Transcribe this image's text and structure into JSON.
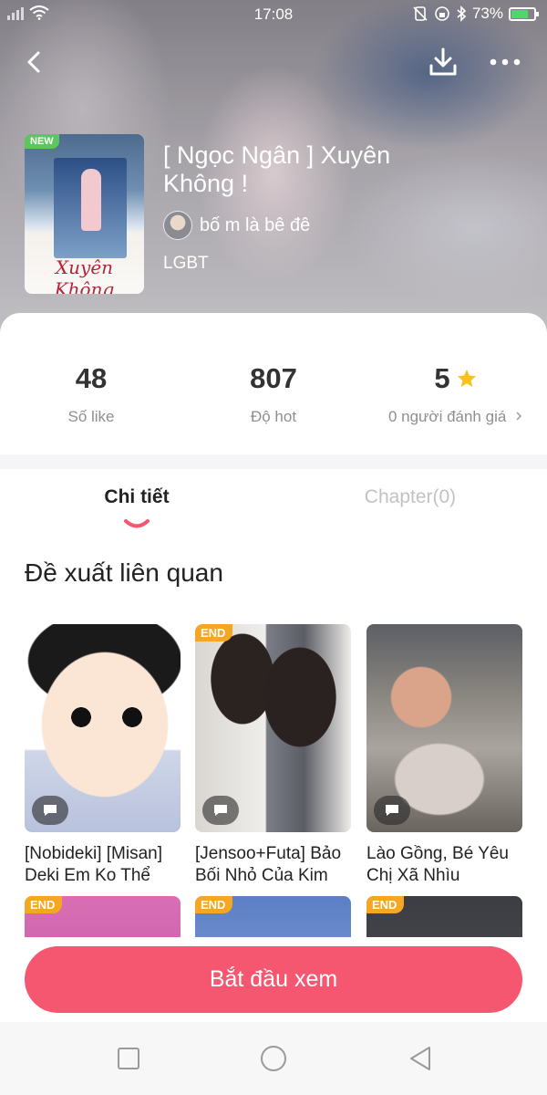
{
  "status_bar": {
    "time": "17:08",
    "battery": "73%",
    "battery_level": 0.73
  },
  "header": {
    "back_icon": "back-arrow-icon",
    "download_icon": "download-icon",
    "more_icon": "more-dots-icon"
  },
  "comic": {
    "cover_text": "Xuyên Không",
    "new_badge": "NEW",
    "title": "[ Ngọc Ngân ] Xuyên Không !",
    "author": "bố m là bê đê",
    "genre": "LGBT"
  },
  "stats": {
    "likes": {
      "value": "48",
      "label": "Số like"
    },
    "hot": {
      "value": "807",
      "label": "Độ hot"
    },
    "rating": {
      "value": "5",
      "label": "0 người đánh giá"
    }
  },
  "tabs": [
    {
      "label": "Chi tiết",
      "active": true
    },
    {
      "label": "Chapter(0)",
      "active": false
    }
  ],
  "related": {
    "title": "Đề xuất liên quan",
    "items": [
      {
        "title": "[Nobideki] [Misan] Deki Em Ko Thể",
        "badge": ""
      },
      {
        "title": "[Jensoo+Futa] Bảo Bối Nhỏ Của Kim",
        "badge": "END"
      },
      {
        "title": "Lào Gồng, Bé Yêu Chị Xã Nhìu",
        "badge": ""
      },
      {
        "badge": "END"
      },
      {
        "badge": "END"
      },
      {
        "badge": "END"
      }
    ]
  },
  "start_button": "Bắt đầu xem",
  "colors": {
    "accent": "#f4576f",
    "star": "#f7c21a",
    "end_badge": "#f5a623",
    "new_badge": "#5ac85a"
  },
  "nav": {
    "icons": [
      "square-icon",
      "circle-icon",
      "triangle-back-icon"
    ]
  }
}
